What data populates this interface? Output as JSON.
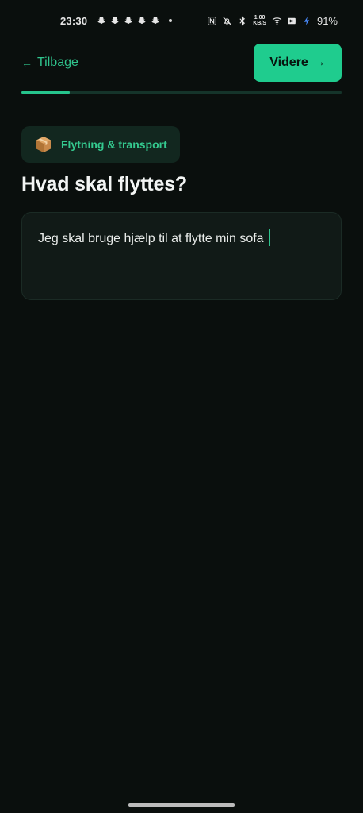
{
  "status_bar": {
    "time": "23:30",
    "network_speed_value": "1.00",
    "network_speed_unit": "KB/S",
    "battery_percent": "91%",
    "icons": [
      "snapchat-icon",
      "nfc-icon",
      "bell-off-icon",
      "bluetooth-icon",
      "wifi-icon",
      "battery-icon",
      "charging-icon"
    ]
  },
  "header": {
    "back_label": "Tilbage",
    "back_arrow": "←",
    "next_label": "Videre",
    "next_arrow": "→"
  },
  "progress": {
    "fraction": 0.15
  },
  "category": {
    "icon": "package-box-icon",
    "label": "Flytning & transport"
  },
  "question": {
    "title": "Hvad skal flyttes?"
  },
  "answer": {
    "value": "Jeg skal bruge hjælp til at flytte min sofa"
  },
  "colors": {
    "accent": "#1fcc8e",
    "background": "#0a0f0d",
    "chip_bg": "#12271f",
    "input_bg": "#111a17"
  }
}
